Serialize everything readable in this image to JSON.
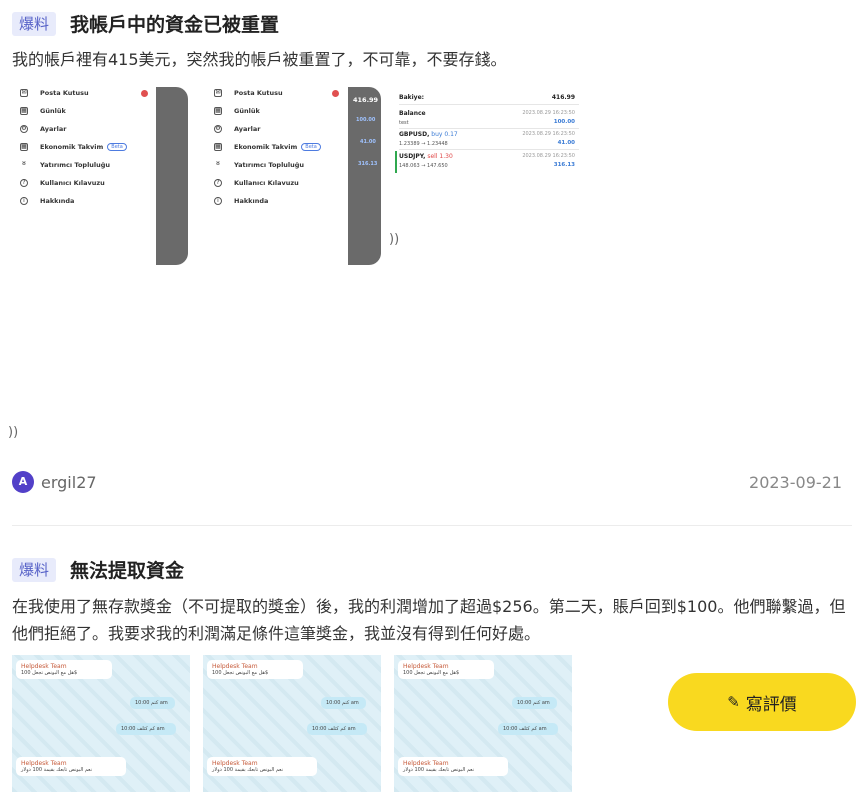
{
  "posts": [
    {
      "tag": "爆料",
      "title": "我帳戶中的資金已被重置",
      "body": "我的帳戶裡有415美元，突然我的帳戶被重置了，不可靠，不要存錢。",
      "user": {
        "avatar_letter": "A",
        "name": "ergil27"
      },
      "date": "2023-09-21",
      "screenshot": {
        "menu_items": [
          {
            "icon": "mail-icon",
            "label": "Posta Kutusu"
          },
          {
            "icon": "calendar-icon",
            "label": "Günlük"
          },
          {
            "icon": "gear-icon",
            "label": "Ayarlar"
          },
          {
            "icon": "calendar-icon",
            "label": "Ekonomik Takvim",
            "badge": "Beta"
          },
          {
            "icon": "people-icon",
            "label": "Yatırımcı Topluluğu"
          },
          {
            "icon": "help-icon",
            "label": "Kullanıcı Kılavuzu"
          },
          {
            "icon": "info-icon",
            "label": "Hakkında"
          }
        ],
        "strip_values": [
          "416.99",
          "100.00",
          "41.00",
          "316.13"
        ],
        "account": {
          "top_label": "Bakiye:",
          "top_value": "416.99",
          "balance_label": "Balance",
          "balance_sub": "test",
          "balance_value": "100.00",
          "gbpusd_label": "GBPUSD,",
          "gbpusd_action": "buy 0.17",
          "gbpusd_prices": "1.23389 → 1.23448",
          "gbpusd_profit": "41.00",
          "usdjpy_label": "USDJPY,",
          "usdjpy_action": "sell 1.30",
          "usdjpy_prices": "148.063 → 147.650",
          "usdjpy_profit": "316.13",
          "timestamp": "2023.08.29 16:23:50"
        }
      }
    },
    {
      "tag": "爆料",
      "title": "無法提取資金",
      "body": "在我使用了無存款獎金（不可提取的獎金）後，我的利潤增加了超過$256。第二天，賬戶回到$100。他們聯繫過，但他們拒絕了。我要求我的利潤滿足條件這筆獎金，我並沒有得到任何好處。",
      "chat": {
        "sender": "Helpdesk Team",
        "msg1": "هل مع البونص تجعل 100$",
        "msg2": "كتم",
        "msg3": "كم كثلف",
        "msg4": "نعم البونص تابعك بقيمة 100 دولار",
        "time": "10:00 am"
      }
    }
  ],
  "review_button": {
    "label": "寫評價"
  },
  "colors": {
    "accent_yellow": "#f9d91f",
    "tag_bg": "#e8ebfb",
    "tag_text": "#5863c8",
    "avatar": "#5240c8"
  }
}
